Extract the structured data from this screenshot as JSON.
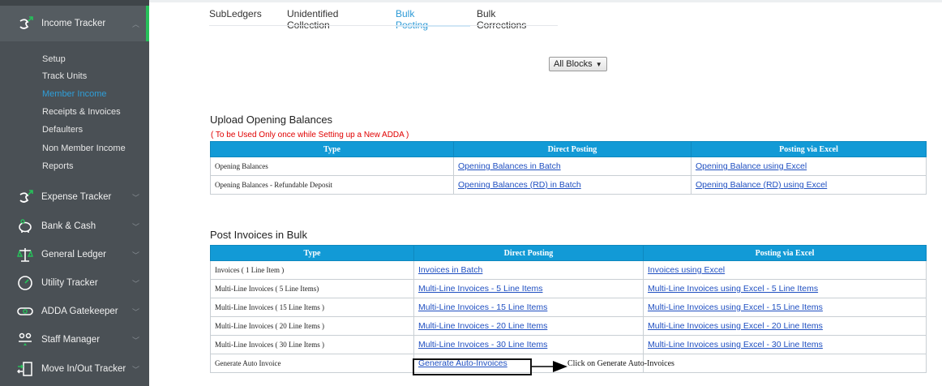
{
  "sidebar": {
    "active_group": "Income Tracker",
    "sub_items": [
      "Setup",
      "Track Units",
      "Member Income",
      "Receipts & Invoices",
      "Defaulters",
      "Non Member Income",
      "Reports"
    ],
    "active_sub_item": "Member Income",
    "groups": [
      "Expense Tracker",
      "Bank & Cash",
      "General Ledger",
      "Utility Tracker",
      "ADDA Gatekeeper",
      "Staff Manager",
      "Move In/Out Tracker"
    ]
  },
  "tabs": [
    "SubLedgers",
    "Unidentified Collection",
    "Bulk Posting",
    "Bulk Corrections"
  ],
  "active_tab": "Bulk Posting",
  "block_select": {
    "value": "All Blocks"
  },
  "opening": {
    "title": "Upload Opening Balances",
    "note": "( To be Used Only once while Setting up a New ADDA )",
    "headers": [
      "Type",
      "Direct Posting",
      "Posting via Excel"
    ],
    "rows": [
      {
        "type": "Opening Balances",
        "direct": "Opening Balances in Batch",
        "excel": "Opening Balance using Excel"
      },
      {
        "type": "Opening Balances - Refundable Deposit",
        "direct": "Opening Balances (RD) in Batch",
        "excel": "Opening Balance (RD) using Excel"
      }
    ]
  },
  "invoices": {
    "title": "Post Invoices in Bulk",
    "headers": [
      "Type",
      "Direct Posting",
      "Posting via Excel"
    ],
    "rows": [
      {
        "type": "Invoices ( 1 Line Item )",
        "direct": "Invoices in Batch",
        "excel": "Invoices using Excel"
      },
      {
        "type": "Multi-Line Invoices ( 5 Line Items)",
        "direct": "Multi-Line Invoices - 5 Line Items",
        "excel": "Multi-Line Invoices using Excel - 5 Line Items"
      },
      {
        "type": "Multi-Line Invoices ( 15 Line Items )",
        "direct": "Multi-Line Invoices - 15 Line Items",
        "excel": "Multi-Line Invoices using Excel - 15 Line Items"
      },
      {
        "type": "Multi-Line Invoices ( 20 Line Items )",
        "direct": "Multi-Line Invoices - 20 Line Items",
        "excel": "Multi-Line Invoices using Excel - 20 Line Items"
      },
      {
        "type": "Multi-Line Invoices ( 30 Line Items )",
        "direct": "Multi-Line Invoices - 30 Line Items",
        "excel": "Multi-Line Invoices using Excel - 30 Line Items"
      },
      {
        "type": "Generate Auto Invoice",
        "direct": "Generate Auto-Invoices",
        "excel": ""
      }
    ]
  },
  "callout": {
    "text": "Click on Generate Auto-Invoices"
  },
  "colors": {
    "sidebar_bg": "#4a5055",
    "accent_green": "#26c05a",
    "header_blue": "#129ad6",
    "link": "#1f4fc1",
    "note_red": "#e00000"
  }
}
